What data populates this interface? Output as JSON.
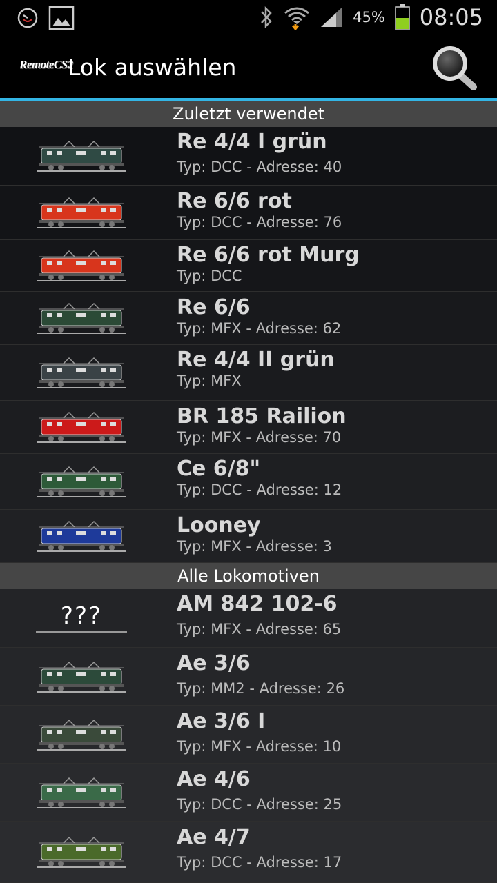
{
  "status_bar": {
    "battery_percent": "45%",
    "time": "08:05",
    "icons": [
      "clock-icon",
      "image-icon",
      "bluetooth-icon",
      "wifi-icon",
      "signal-icon",
      "battery-icon"
    ]
  },
  "action_bar": {
    "logo_text": "RemoteCS2",
    "title": "Lok auswählen",
    "search_icon": "search-icon"
  },
  "sections": [
    {
      "title": "Zuletzt verwendet",
      "items": [
        {
          "name": "Re 4/4 I grün",
          "info": "Typ: DCC - Adresse: 40",
          "color": "#2f4a44"
        },
        {
          "name": "Re 6/6 rot",
          "info": "Typ: DCC - Adresse: 76",
          "color": "#d8351c"
        },
        {
          "name": "Re 6/6 rot Murg",
          "info": "Typ: DCC",
          "color": "#d8351c"
        },
        {
          "name": "Re 6/6",
          "info": "Typ: MFX - Adresse: 62",
          "color": "#2b4a36"
        },
        {
          "name": "Re 4/4 II grün",
          "info": "Typ: MFX",
          "color": "#3a4246"
        },
        {
          "name": "BR 185 Railion",
          "info": "Typ: MFX - Adresse: 70",
          "color": "#cc1a1a"
        },
        {
          "name": "Ce 6/8\"",
          "info": "Typ: DCC - Adresse: 12",
          "color": "#2d5a38"
        },
        {
          "name": "Looney",
          "info": "Typ: MFX - Adresse: 3",
          "color": "#1e3a9a"
        }
      ]
    },
    {
      "title": "Alle Lokomotiven",
      "items": [
        {
          "name": "AM 842 102-6",
          "info": "Typ: MFX - Adresse: 65",
          "placeholder": "???"
        },
        {
          "name": "Ae 3/6",
          "info": "Typ: MM2 - Adresse: 26",
          "color": "#2c4a3a"
        },
        {
          "name": "Ae 3/6 I",
          "info": "Typ: MFX - Adresse: 10",
          "color": "#3a4a3a"
        },
        {
          "name": "Ae 4/6",
          "info": "Typ: DCC - Adresse: 25",
          "color": "#3a6a48"
        },
        {
          "name": "Ae 4/7",
          "info": "Typ: DCC - Adresse: 17",
          "color": "#4a6a2a"
        }
      ]
    }
  ]
}
